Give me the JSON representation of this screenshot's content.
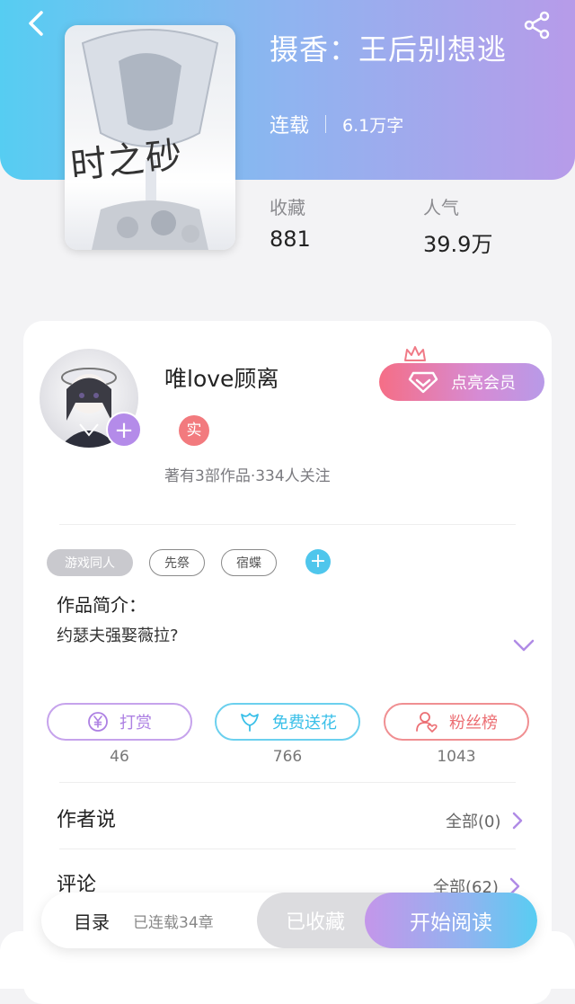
{
  "book": {
    "title": "摄香：王后别想逃",
    "status": "连载",
    "word_count": "6.1万字",
    "cover_caption": "时之砂",
    "stats": [
      {
        "label": "收藏",
        "value": "881"
      },
      {
        "label": "人气",
        "value": "39.9万"
      }
    ]
  },
  "author": {
    "name": "唯love顾离",
    "verify_badge": "实",
    "stats": "著有3部作品·334人关注",
    "follow_symbol": "+"
  },
  "vip": {
    "label": "点亮会员"
  },
  "tags": {
    "items": [
      "游戏同人",
      "先祭",
      "宿蝶"
    ],
    "add_symbol": "+"
  },
  "intro": {
    "heading": "作品简介：",
    "text": "约瑟夫强娶薇拉?"
  },
  "actions": [
    {
      "label": "打赏",
      "count": "46",
      "icon": "yen-coin-icon"
    },
    {
      "label": "免费送花",
      "count": "766",
      "icon": "flower-icon"
    },
    {
      "label": "粉丝榜",
      "count": "1043",
      "icon": "fan-user-icon"
    }
  ],
  "sections": [
    {
      "title": "作者说",
      "link": "全部(0)"
    },
    {
      "title": "评论",
      "link": "全部(62)"
    }
  ],
  "bottom_bar": {
    "toc": "目录",
    "chapters": "已连载34章",
    "collected": "已收藏",
    "read": "开始阅读"
  },
  "colors": {
    "header_gradient": [
      "#56cdf2",
      "#b79be9"
    ],
    "accent_purple": "#b48be9",
    "accent_blue": "#38bfe8",
    "accent_red": "#ec6f74"
  }
}
